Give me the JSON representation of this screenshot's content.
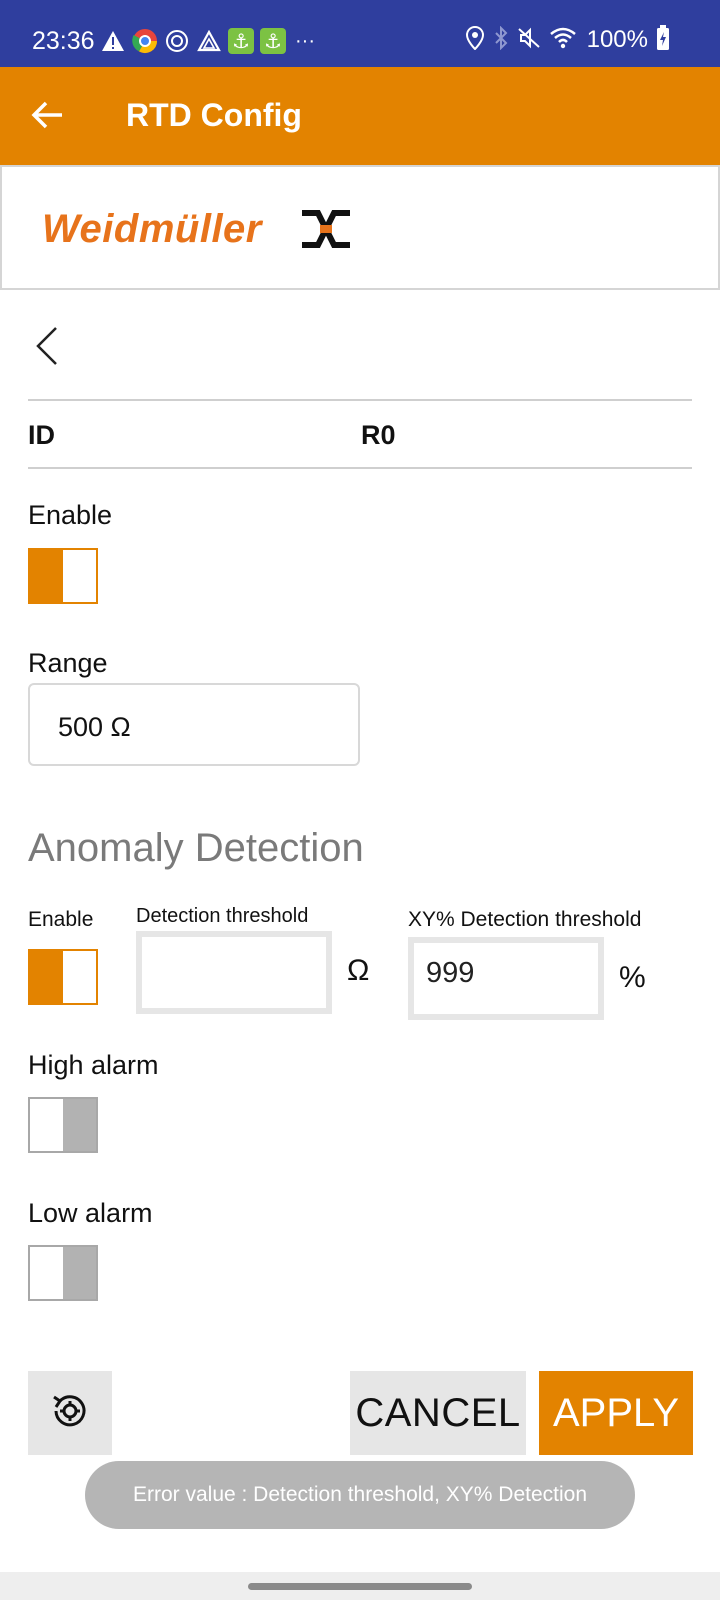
{
  "status_bar": {
    "time": "23:36",
    "battery": "100%",
    "left_icons": [
      "warning-icon",
      "chrome-icon",
      "vpn-icon",
      "drive-icon",
      "anchor-icon",
      "anchor-icon",
      "more-icon"
    ],
    "right_icons": [
      "location-icon",
      "bluetooth-icon",
      "mute-icon",
      "wifi-icon",
      "battery-icon"
    ]
  },
  "app_bar": {
    "title": "RTD Config",
    "back_icon": "arrow-left-icon"
  },
  "logo": {
    "text": "Weidmüller",
    "brand_color": "#e7731b"
  },
  "channel": {
    "id_label": "ID",
    "id_value": "R0"
  },
  "enable": {
    "label": "Enable",
    "on": true
  },
  "range": {
    "label": "Range",
    "value": "500 Ω"
  },
  "anomaly": {
    "title": "Anomaly Detection",
    "enable_label": "Enable",
    "enable_on": true,
    "detection_threshold_label": "Detection threshold",
    "detection_threshold_value": "",
    "detection_threshold_unit": "Ω",
    "xy_threshold_label": "XY% Detection threshold",
    "xy_threshold_value": "999",
    "xy_threshold_unit": "%"
  },
  "high_alarm": {
    "label": "High alarm",
    "on": false
  },
  "low_alarm": {
    "label": "Low alarm",
    "on": false
  },
  "buttons": {
    "cancel": "CANCEL",
    "apply": "APPLY",
    "reset_icon": "reset-settings-icon"
  },
  "toast": "Error value : Detection threshold, XY% Detection",
  "colors": {
    "status_bar": "#2f3e9e",
    "accent": "#e38300",
    "toggle_off": "#b2b2b2"
  }
}
